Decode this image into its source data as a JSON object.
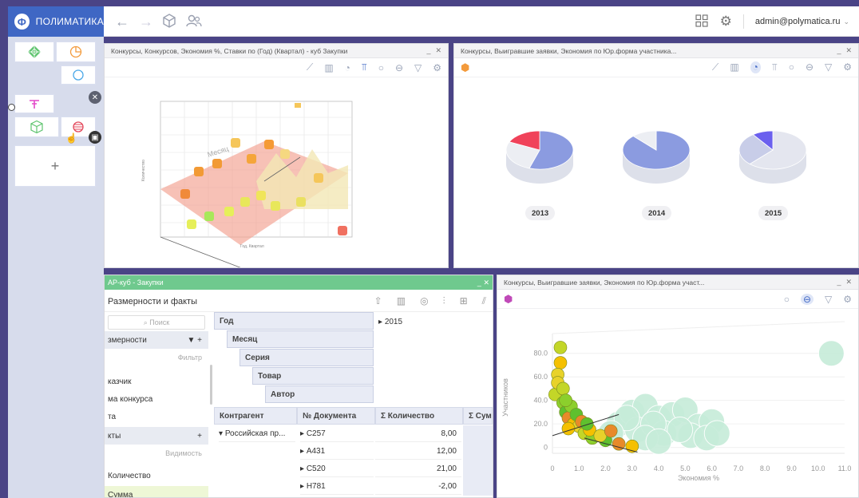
{
  "app": {
    "brand": "ПОЛИМАТИКА",
    "user": "admin@polymatica.ru"
  },
  "icons": {
    "logo": "polymatica-logo",
    "back": "arrow-left-icon",
    "forward": "arrow-right-icon",
    "cube": "cube-icon",
    "users": "users-icon",
    "grid": "grid-icon",
    "settings": "gear-icon",
    "chevron": "chevron-down-icon"
  },
  "windows": {
    "w1": {
      "title": "Конкурсы, Конкурсов, Экономия %, Ставки по (Год) (Квартал) - куб Закупки",
      "xaxis": "Год, Квартал",
      "yaxis": "Количество",
      "zlabel": "Месяц"
    },
    "w2": {
      "title": "Конкурсы, Выигравшие заявки, Экономия по Юр.форма участника...",
      "pies": [
        "2013",
        "2014",
        "2015"
      ]
    },
    "w3": {
      "title": "Конкурсы, Выигравшие заявки, Экономия по Юр.форма участ...",
      "yaxis": "Участников",
      "xaxis": "Экономия %"
    },
    "olap": {
      "title": "АР-куб - Закупки",
      "tab": "Размерности и факты",
      "search": "Поиск",
      "dims_header": "змерности",
      "filter_label": "Фильтр",
      "dims": [
        "казчик",
        "ма конкурса",
        "та"
      ],
      "facts_header": "кты",
      "visibility": "Видимость",
      "facts": [
        "Количество",
        "Сумма"
      ],
      "pivot_cols": [
        "Год",
        "Месяц",
        "Серия",
        "Товар",
        "Автор"
      ],
      "year_value": "2015",
      "columns": [
        "Контрагент",
        "№ Документа",
        "Σ Количество",
        "Σ Сум"
      ],
      "row_group": "Российская пр...",
      "rows": [
        {
          "doc": "C257",
          "qty": "8,00"
        },
        {
          "doc": "A431",
          "qty": "12,00"
        },
        {
          "doc": "C520",
          "qty": "21,00"
        },
        {
          "doc": "H781",
          "qty": "-2,00"
        }
      ]
    }
  },
  "chart_data": [
    {
      "type": "pie",
      "categories": [
        "2013",
        "2014",
        "2015"
      ],
      "series": [
        {
          "values": [
            55,
            27,
            18
          ]
        },
        {
          "values": [
            88,
            12,
            0
          ]
        },
        {
          "values": [
            62,
            28,
            10
          ]
        }
      ]
    },
    {
      "type": "scatter",
      "xlabel": "Экономия %",
      "ylabel": "Участников",
      "xticks": [
        "0",
        "1.0",
        "2.0",
        "3.0",
        "4.0",
        "5.0",
        "6.0",
        "7.0",
        "8.0",
        "9.0",
        "10.0",
        "11.0"
      ],
      "yticks": [
        "0",
        "20.0",
        "40.0",
        "60.0",
        "80.0"
      ],
      "xlim": [
        0,
        11
      ],
      "ylim": [
        -5,
        90
      ],
      "series": [
        {
          "points": [
            [
              0.3,
              72
            ],
            [
              0.2,
              62
            ],
            [
              0.1,
              45
            ],
            [
              0.4,
              38
            ],
            [
              0.5,
              30
            ],
            [
              0.6,
              25
            ],
            [
              0.8,
              20
            ],
            [
              1.0,
              18
            ],
            [
              1.2,
              12
            ],
            [
              1.5,
              8
            ],
            [
              2.0,
              6
            ],
            [
              2.5,
              3
            ],
            [
              3.0,
              1
            ],
            [
              0.2,
              55
            ],
            [
              0.4,
              50
            ],
            [
              0.7,
              35
            ],
            [
              0.9,
              28
            ],
            [
              1.1,
              22
            ],
            [
              1.4,
              15
            ],
            [
              1.8,
              10
            ],
            [
              0.3,
              85
            ],
            [
              0.5,
              40
            ],
            [
              1.3,
              20
            ],
            [
              2.2,
              14
            ],
            [
              0.6,
              16
            ]
          ]
        },
        {
          "points": [
            [
              2.5,
              20
            ],
            [
              3.0,
              30
            ],
            [
              3.5,
              35
            ],
            [
              4.0,
              25
            ],
            [
              4.5,
              28
            ],
            [
              5.0,
              32
            ],
            [
              5.5,
              18
            ],
            [
              6.0,
              22
            ],
            [
              3.2,
              15
            ],
            [
              4.2,
              12
            ],
            [
              5.2,
              10
            ],
            [
              2.8,
              25
            ],
            [
              3.8,
              20
            ],
            [
              4.8,
              15
            ],
            [
              5.8,
              8
            ],
            [
              6.2,
              12
            ],
            [
              10.5,
              80
            ],
            [
              3.5,
              8
            ],
            [
              4.0,
              5
            ],
            [
              2.2,
              12
            ]
          ]
        }
      ]
    }
  ]
}
